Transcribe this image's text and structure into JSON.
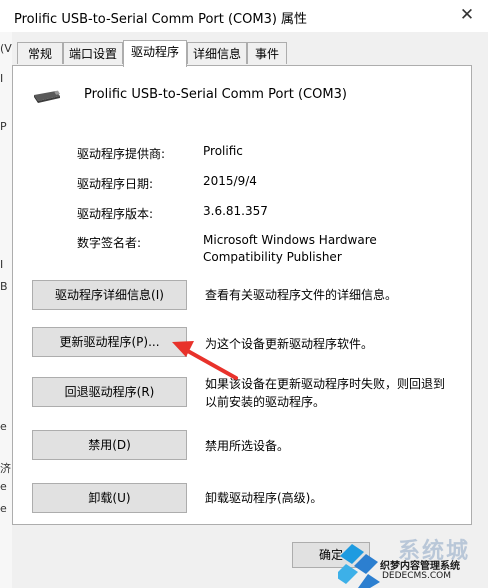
{
  "window": {
    "title": "Prolific USB-to-Serial Comm Port (COM3) 属性",
    "close_glyph": "✕"
  },
  "background_window": {
    "fragments": [
      "(V",
      "I",
      "P",
      "I",
      "B",
      "e",
      "济",
      "e",
      "e"
    ]
  },
  "tabs": [
    {
      "label": "常规",
      "active": false
    },
    {
      "label": "端口设置",
      "active": false
    },
    {
      "label": "驱动程序",
      "active": true
    },
    {
      "label": "详细信息",
      "active": false
    },
    {
      "label": "事件",
      "active": false
    }
  ],
  "device": {
    "icon": "usb-serial-device-icon",
    "name": "Prolific USB-to-Serial Comm Port (COM3)"
  },
  "driver_info": [
    {
      "label": "驱动程序提供商:",
      "value": "Prolific"
    },
    {
      "label": "驱动程序日期:",
      "value": "2015/9/4"
    },
    {
      "label": "驱动程序版本:",
      "value": "3.6.81.357"
    },
    {
      "label": "数字签名者:",
      "value_line1": "Microsoft Windows Hardware",
      "value_line2": "Compatibility Publisher"
    }
  ],
  "actions": [
    {
      "button": "驱动程序详细信息(I)",
      "desc": "查看有关驱动程序文件的详细信息。"
    },
    {
      "button": "更新驱动程序(P)...",
      "desc": "为这个设备更新驱动程序软件。"
    },
    {
      "button": "回退驱动程序(R)",
      "desc_line1": "如果该设备在更新驱动程序时失败，则回退到",
      "desc_line2": "以前安装的驱动程序。"
    },
    {
      "button": "禁用(D)",
      "desc": "禁用所选设备。"
    },
    {
      "button": "卸载(U)",
      "desc": "卸载驱动程序(高级)。"
    }
  ],
  "footer": {
    "ok_label": "确定"
  },
  "watermark": {
    "brand": "系统城",
    "subtitle": "织梦内容管理系统",
    "url": "DEDECMS.COM"
  },
  "colors": {
    "arrow": "#e8322b",
    "window_bg": "#f0f0f0",
    "panel_bg": "#ffffff",
    "button_bg": "#e1e1e1"
  }
}
